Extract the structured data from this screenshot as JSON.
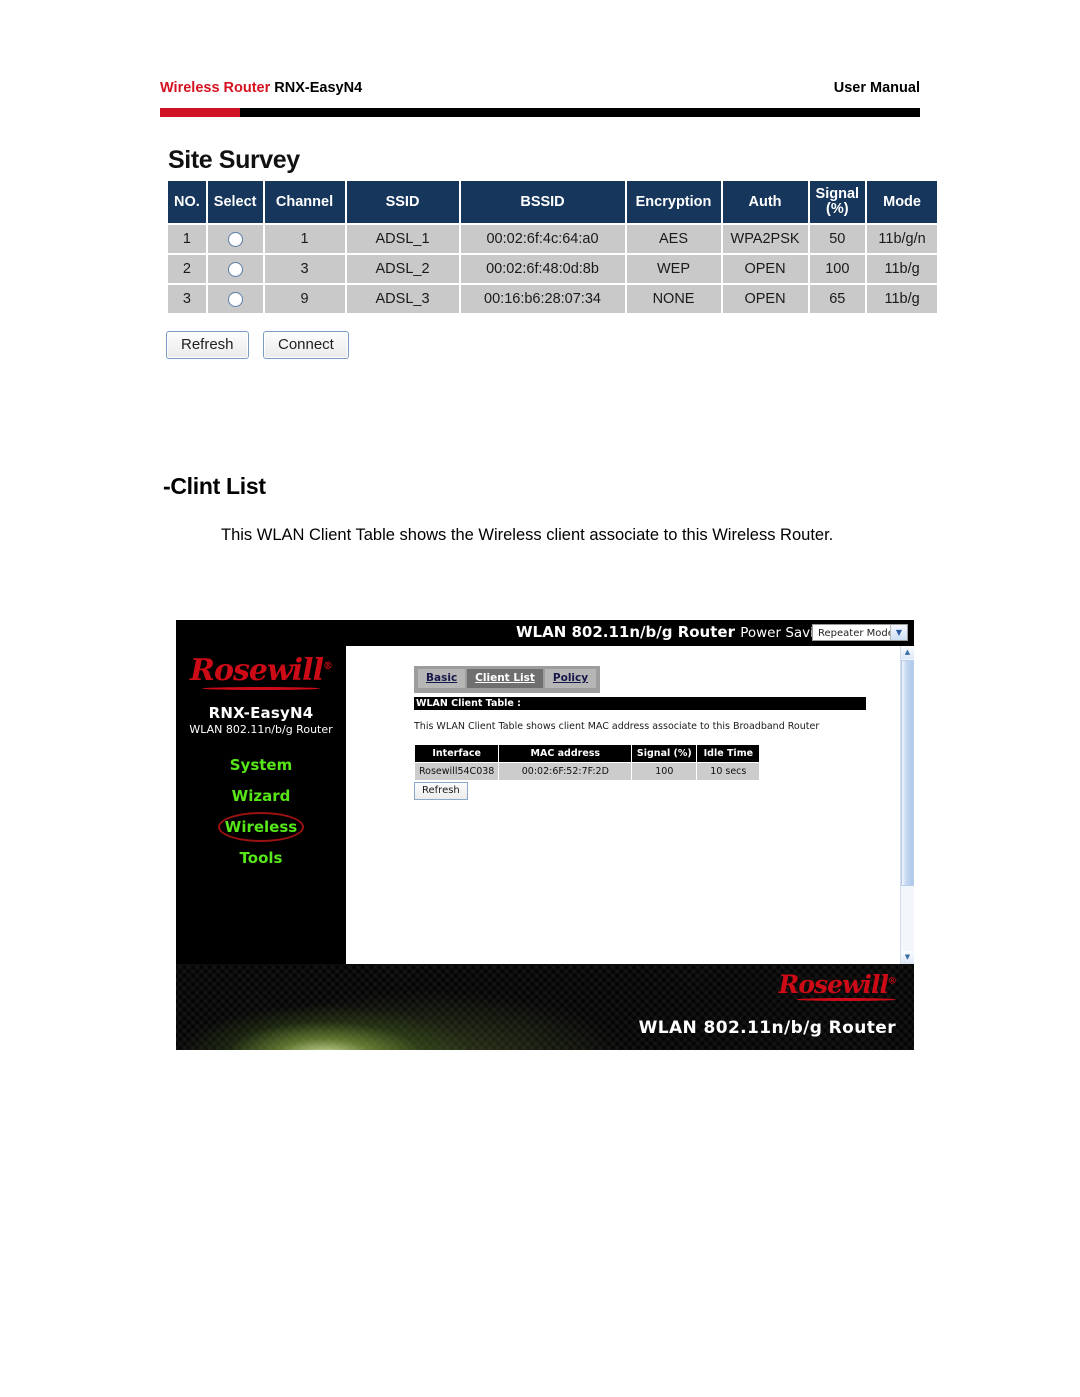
{
  "page_header": {
    "left_red": "Wireless Router",
    "left_black": "RNX-EasyN4",
    "right": "User Manual"
  },
  "site_survey": {
    "title": "Site Survey",
    "columns": [
      "NO.",
      "Select",
      "Channel",
      "SSID",
      "BSSID",
      "Encryption",
      "Auth",
      "Signal (%)",
      "Mode"
    ],
    "column_signal_line1": "Signal",
    "column_signal_line2": "(%)",
    "rows": [
      {
        "no": "1",
        "channel": "1",
        "ssid": "ADSL_1",
        "bssid": "00:02:6f:4c:64:a0",
        "encryption": "AES",
        "auth": "WPA2PSK",
        "signal": "50",
        "mode": "11b/g/n",
        "selected": false
      },
      {
        "no": "2",
        "channel": "3",
        "ssid": "ADSL_2",
        "bssid": "00:02:6f:48:0d:8b",
        "encryption": "WEP",
        "auth": "OPEN",
        "signal": "100",
        "mode": "11b/g",
        "selected": false
      },
      {
        "no": "3",
        "channel": "9",
        "ssid": "ADSL_3",
        "bssid": "00:16:b6:28:07:34",
        "encryption": "NONE",
        "auth": "OPEN",
        "signal": "65",
        "mode": "11b/g",
        "selected": false
      }
    ],
    "buttons": {
      "refresh": "Refresh",
      "connect": "Connect"
    }
  },
  "section": {
    "heading": "-Clint List",
    "paragraph": "This WLAN Client Table shows the Wireless client associate to this Wireless Router."
  },
  "router_ui": {
    "topbar": {
      "title_bold": "WLAN 802.11n/b/g Router",
      "title_sub": "Power Saving Edition",
      "mode_select_value": "Repeater Mode"
    },
    "sidebar": {
      "brand": "Rosewill",
      "model": "RNX-EasyN4",
      "model_sub": "WLAN 802.11n/b/g Router",
      "menu": [
        {
          "label": "System",
          "circled": false
        },
        {
          "label": "Wizard",
          "circled": false
        },
        {
          "label": "Wireless",
          "circled": true
        },
        {
          "label": "Tools",
          "circled": false
        }
      ]
    },
    "content": {
      "tabs": [
        {
          "label": "Basic",
          "active": false
        },
        {
          "label": "Client List",
          "active": true
        },
        {
          "label": "Policy",
          "active": false
        }
      ],
      "table_bar": "WLAN Client Table :",
      "description": "This WLAN Client Table shows client MAC address associate to this Broadband Router",
      "columns": [
        "Interface",
        "MAC address",
        "Signal (%)",
        "Idle Time"
      ],
      "rows": [
        {
          "interface": "Rosewill54C038",
          "mac": "00:02:6F:52:7F:2D",
          "signal": "100",
          "idle_time": "10 secs"
        }
      ],
      "refresh_button": "Refresh"
    },
    "banner": {
      "brand": "Rosewill",
      "title": "WLAN 802.11n/b/g Router"
    }
  },
  "colors": {
    "brand_red": "#cc0b16",
    "header_red": "#d41220",
    "table_header_navy": "#16365c",
    "table_cell_gray": "#c9c9c9",
    "menu_green": "#57e618",
    "circle_red": "#9b1212"
  }
}
